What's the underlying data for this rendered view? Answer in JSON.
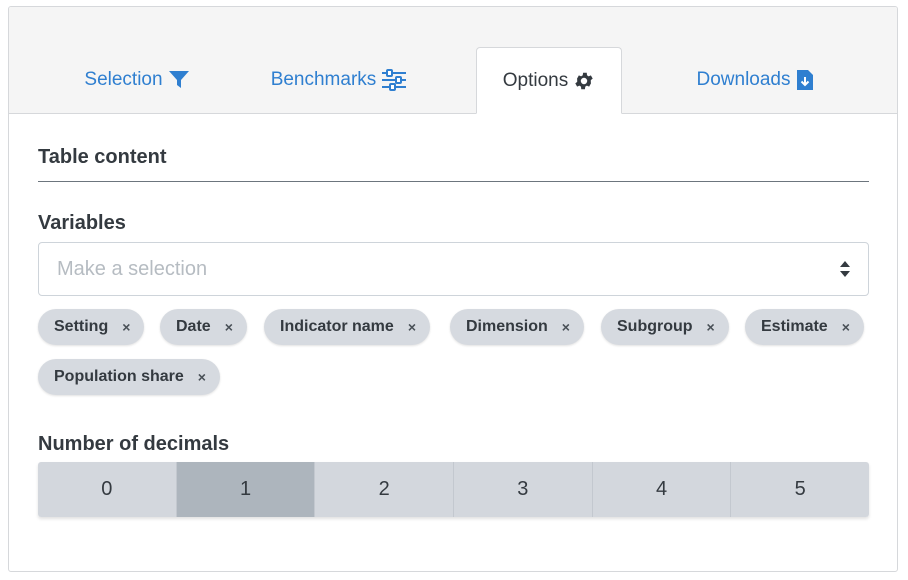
{
  "tabs": [
    {
      "label": "Selection",
      "icon": "filter-icon",
      "active": false
    },
    {
      "label": "Benchmarks",
      "icon": "sliders-icon",
      "active": false
    },
    {
      "label": "Options",
      "icon": "gear-icon",
      "active": true
    },
    {
      "label": "Downloads",
      "icon": "file-download-icon",
      "active": false
    }
  ],
  "colors": {
    "link": "#2f7fd0",
    "chip_bg": "#d6dae0",
    "segment_bg": "#d3d7dd",
    "segment_active_bg": "#adb5bd"
  },
  "table_content": {
    "title": "Table content"
  },
  "variables": {
    "label": "Variables",
    "placeholder": "Make a selection",
    "selected": [
      "Setting",
      "Date",
      "Indicator name",
      "Dimension",
      "Subgroup",
      "Estimate",
      "Population share"
    ],
    "remove_symbol": "×"
  },
  "decimals": {
    "label": "Number of decimals",
    "options": [
      "0",
      "1",
      "2",
      "3",
      "4",
      "5"
    ],
    "selected": "1"
  }
}
